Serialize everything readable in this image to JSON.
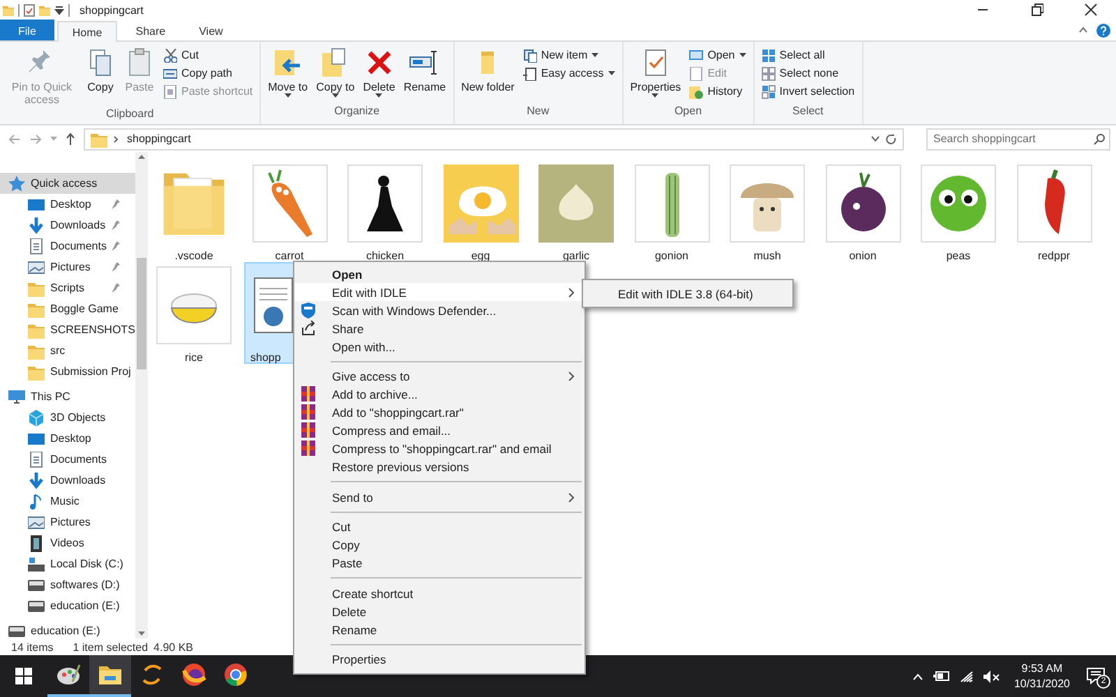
{
  "window": {
    "title": "shoppingcart"
  },
  "ribbon": {
    "tabs": [
      {
        "label": "File",
        "kind": "file",
        "selected": false
      },
      {
        "label": "Home",
        "kind": "tab",
        "selected": true
      },
      {
        "label": "Share",
        "kind": "tab",
        "selected": false
      },
      {
        "label": "View",
        "kind": "tab",
        "selected": false
      }
    ],
    "groups": [
      {
        "label": "Clipboard",
        "buttons": [
          {
            "label": "Pin to Quick access",
            "kind": "large",
            "disabled": true,
            "dropdown": false
          },
          {
            "label": "Copy",
            "kind": "large",
            "disabled": false,
            "dropdown": false
          },
          {
            "label": "Paste",
            "kind": "large",
            "disabled": true,
            "dropdown": false
          },
          {
            "label": "Cut",
            "kind": "small",
            "disabled": false,
            "dropdown": false
          },
          {
            "label": "Copy path",
            "kind": "small",
            "disabled": false,
            "dropdown": false
          },
          {
            "label": "Paste shortcut",
            "kind": "small",
            "disabled": true,
            "dropdown": false
          }
        ]
      },
      {
        "label": "Organize",
        "buttons": [
          {
            "label": "Move to",
            "kind": "large",
            "disabled": false,
            "dropdown": true
          },
          {
            "label": "Copy to",
            "kind": "large",
            "disabled": false,
            "dropdown": true
          },
          {
            "label": "Delete",
            "kind": "large",
            "disabled": false,
            "dropdown": true
          },
          {
            "label": "Rename",
            "kind": "large",
            "disabled": false,
            "dropdown": false
          }
        ]
      },
      {
        "label": "New",
        "buttons": [
          {
            "label": "New folder",
            "kind": "large",
            "disabled": false,
            "dropdown": false
          },
          {
            "label": "New item",
            "kind": "small",
            "disabled": false,
            "dropdown": true
          },
          {
            "label": "Easy access",
            "kind": "small",
            "disabled": false,
            "dropdown": true
          }
        ]
      },
      {
        "label": "Open",
        "buttons": [
          {
            "label": "Properties",
            "kind": "large",
            "disabled": false,
            "dropdown": true
          },
          {
            "label": "Open",
            "kind": "small",
            "disabled": false,
            "dropdown": true
          },
          {
            "label": "Edit",
            "kind": "small",
            "disabled": true,
            "dropdown": false
          },
          {
            "label": "History",
            "kind": "small",
            "disabled": false,
            "dropdown": false
          }
        ]
      },
      {
        "label": "Select",
        "buttons": [
          {
            "label": "Select all",
            "kind": "small",
            "disabled": false,
            "dropdown": false
          },
          {
            "label": "Select none",
            "kind": "small",
            "disabled": false,
            "dropdown": false
          },
          {
            "label": "Invert selection",
            "kind": "small",
            "disabled": false,
            "dropdown": false
          }
        ]
      }
    ]
  },
  "address_bar": {
    "path": [
      "shoppingcart"
    ]
  },
  "search": {
    "placeholder": "Search shoppingcart"
  },
  "sidebar": {
    "items": [
      {
        "label": "Quick access",
        "selected": true,
        "pinned": false,
        "children": [
          {
            "label": "Desktop",
            "selected": false,
            "pinned": true
          },
          {
            "label": "Downloads",
            "selected": false,
            "pinned": true
          },
          {
            "label": "Documents",
            "selected": false,
            "pinned": true
          },
          {
            "label": "Pictures",
            "selected": false,
            "pinned": true
          },
          {
            "label": "Scripts",
            "selected": false,
            "pinned": true
          },
          {
            "label": "Boggle Game",
            "selected": false,
            "pinned": false
          },
          {
            "label": "SCREENSHOTS",
            "selected": false,
            "pinned": false
          },
          {
            "label": "src",
            "selected": false,
            "pinned": false
          },
          {
            "label": "Submission Proj",
            "selected": false,
            "pinned": false
          }
        ]
      },
      {
        "label": "This PC",
        "selected": false,
        "pinned": false,
        "children": [
          {
            "label": "3D Objects",
            "selected": false,
            "pinned": false
          },
          {
            "label": "Desktop",
            "selected": false,
            "pinned": false
          },
          {
            "label": "Documents",
            "selected": false,
            "pinned": false
          },
          {
            "label": "Downloads",
            "selected": false,
            "pinned": false
          },
          {
            "label": "Music",
            "selected": false,
            "pinned": false
          },
          {
            "label": "Pictures",
            "selected": false,
            "pinned": false
          },
          {
            "label": "Videos",
            "selected": false,
            "pinned": false
          },
          {
            "label": "Local Disk (C:)",
            "selected": false,
            "pinned": false
          },
          {
            "label": "softwares (D:)",
            "selected": false,
            "pinned": false
          },
          {
            "label": "education (E:)",
            "selected": false,
            "pinned": false
          }
        ]
      },
      {
        "label": "education (E:)",
        "selected": false,
        "pinned": false
      }
    ]
  },
  "files": [
    {
      "name": ".vscode",
      "kind": "folder",
      "selected": false
    },
    {
      "name": "carrot",
      "kind": "image",
      "selected": false
    },
    {
      "name": "chicken",
      "kind": "image",
      "selected": false
    },
    {
      "name": "egg",
      "kind": "image",
      "selected": false
    },
    {
      "name": "garlic",
      "kind": "image",
      "selected": false
    },
    {
      "name": "gonion",
      "kind": "image",
      "selected": false
    },
    {
      "name": "mush",
      "kind": "image",
      "selected": false
    },
    {
      "name": "onion",
      "kind": "image",
      "selected": false
    },
    {
      "name": "peas",
      "kind": "image",
      "selected": false
    },
    {
      "name": "redppr",
      "kind": "image",
      "selected": false
    },
    {
      "name": "rice",
      "kind": "image",
      "selected": false
    },
    {
      "name": "shopp",
      "kind": "file",
      "selected": true
    }
  ],
  "context_menu": {
    "items": [
      {
        "kind": "item",
        "label": "Open",
        "default": true,
        "selected": false,
        "submenu": false
      },
      {
        "kind": "item",
        "label": "Edit with IDLE",
        "default": false,
        "selected": true,
        "submenu": true
      },
      {
        "kind": "item",
        "label": "Scan with Windows Defender...",
        "default": false,
        "selected": false,
        "submenu": false
      },
      {
        "kind": "item",
        "label": "Share",
        "default": false,
        "selected": false,
        "submenu": false
      },
      {
        "kind": "item",
        "label": "Open with...",
        "default": false,
        "selected": false,
        "submenu": false
      },
      {
        "kind": "separator"
      },
      {
        "kind": "item",
        "label": "Give access to",
        "default": false,
        "selected": false,
        "submenu": true
      },
      {
        "kind": "item",
        "label": "Add to archive...",
        "default": false,
        "selected": false,
        "submenu": false
      },
      {
        "kind": "item",
        "label": "Add to \"shoppingcart.rar\"",
        "default": false,
        "selected": false,
        "submenu": false
      },
      {
        "kind": "item",
        "label": "Compress and email...",
        "default": false,
        "selected": false,
        "submenu": false
      },
      {
        "kind": "item",
        "label": "Compress to \"shoppingcart.rar\" and email",
        "default": false,
        "selected": false,
        "submenu": false
      },
      {
        "kind": "item",
        "label": "Restore previous versions",
        "default": false,
        "selected": false,
        "submenu": false
      },
      {
        "kind": "separator"
      },
      {
        "kind": "item",
        "label": "Send to",
        "default": false,
        "selected": false,
        "submenu": true
      },
      {
        "kind": "separator"
      },
      {
        "kind": "item",
        "label": "Cut",
        "default": false,
        "selected": false,
        "submenu": false
      },
      {
        "kind": "item",
        "label": "Copy",
        "default": false,
        "selected": false,
        "submenu": false
      },
      {
        "kind": "item",
        "label": "Paste",
        "default": false,
        "selected": false,
        "submenu": false
      },
      {
        "kind": "separator"
      },
      {
        "kind": "item",
        "label": "Create shortcut",
        "default": false,
        "selected": false,
        "submenu": false
      },
      {
        "kind": "item",
        "label": "Delete",
        "default": false,
        "selected": false,
        "submenu": false
      },
      {
        "kind": "item",
        "label": "Rename",
        "default": false,
        "selected": false,
        "submenu": false
      },
      {
        "kind": "separator"
      },
      {
        "kind": "item",
        "label": "Properties",
        "default": false,
        "selected": false,
        "submenu": false
      }
    ],
    "submenu": {
      "items": [
        {
          "label": "Edit with IDLE 3.8 (64-bit)",
          "selected": false
        }
      ]
    }
  },
  "status_bar": {
    "item_count": "14 items",
    "selection": "1 item selected",
    "size": "4.90 KB"
  },
  "taskbar": {
    "apps": [
      {
        "running": true,
        "active": false
      },
      {
        "running": true,
        "active": true
      },
      {
        "running": false,
        "active": false
      },
      {
        "running": false,
        "active": false
      },
      {
        "running": false,
        "active": false
      }
    ],
    "clock": {
      "time": "9:53 AM",
      "date": "10/31/2020"
    },
    "notifications": "2"
  }
}
